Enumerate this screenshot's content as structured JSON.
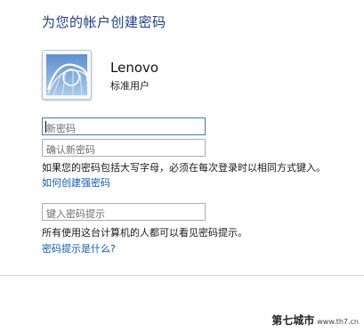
{
  "page": {
    "title": "为您的帐户创建密码"
  },
  "user": {
    "name": "Lenovo",
    "type": "标准用户"
  },
  "form": {
    "new_password_placeholder": "新密码",
    "confirm_password_placeholder": "确认新密码",
    "case_sensitive_note": "如果您的密码包括大写字母，必须在每次登录时以相同方式键入。",
    "strong_password_link": "如何创建强密码",
    "hint_placeholder": "键入密码提示",
    "hint_note": "所有使用这台计算机的人都可以看见密码提示。",
    "hint_link": "密码提示是什么?"
  },
  "watermark": {
    "brand": "第七城市",
    "url": "www.th7.cn"
  },
  "colors": {
    "title": "#1e3f8a",
    "link": "#0f5bb3",
    "focus_border": "#3d7bad"
  }
}
